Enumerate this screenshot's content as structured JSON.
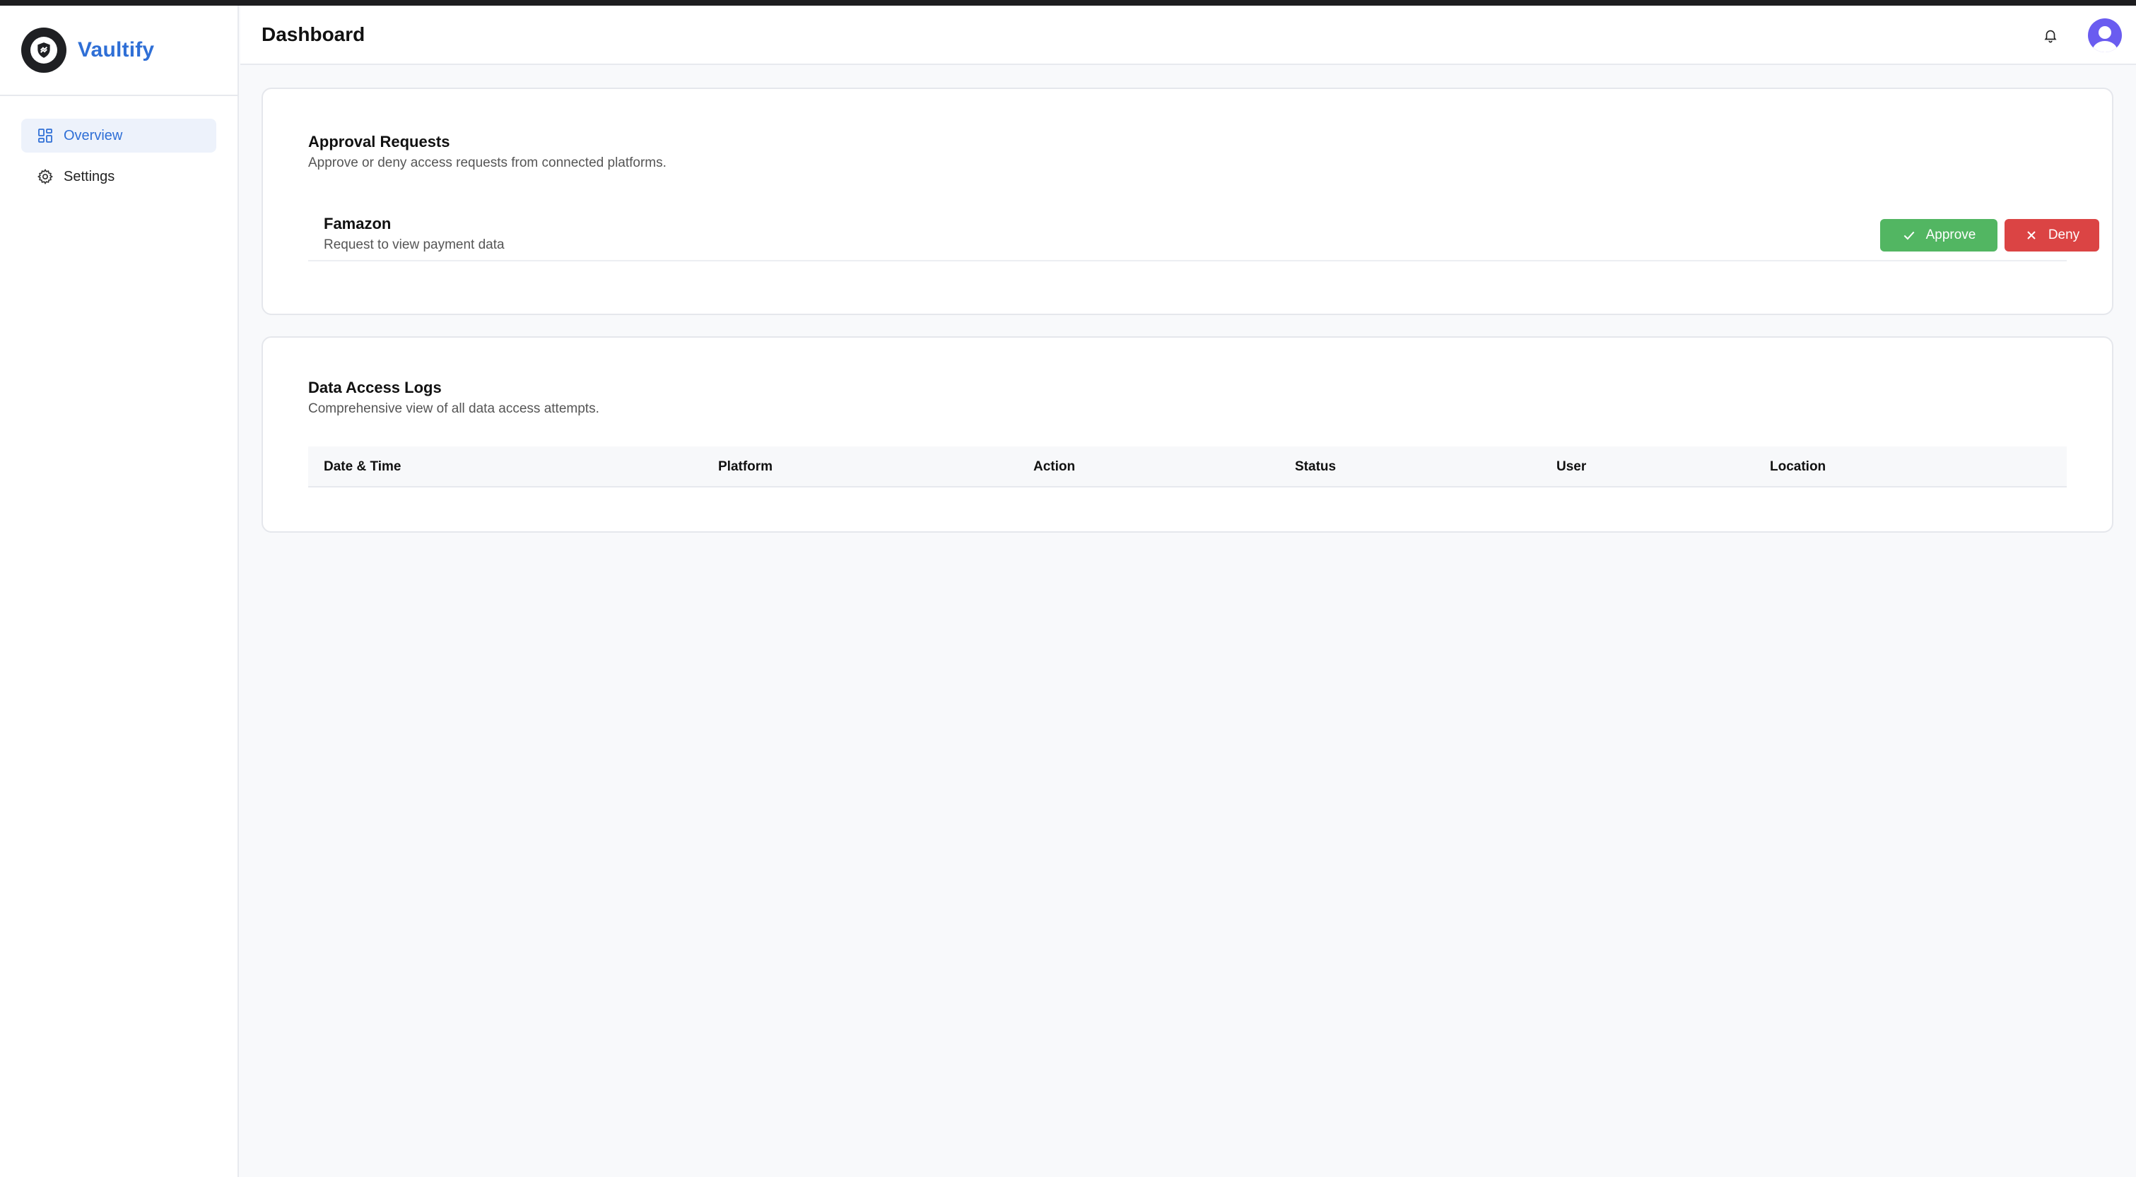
{
  "app": {
    "name": "Vaultify",
    "logo_icon": "shield-logo-icon"
  },
  "sidebar": {
    "items": [
      {
        "label": "Overview",
        "icon": "dashboard-grid-icon",
        "active": true
      },
      {
        "label": "Settings",
        "icon": "gear-icon",
        "active": false
      }
    ]
  },
  "header": {
    "title": "Dashboard",
    "notification_icon": "bell-icon",
    "avatar_icon": "user-avatar-icon"
  },
  "approvals": {
    "title": "Approval Requests",
    "subtitle": "Approve or deny access requests from connected platforms.",
    "requests": [
      {
        "platform": "Famazon",
        "description": "Request to view payment data",
        "approve_label": "Approve",
        "deny_label": "Deny"
      }
    ]
  },
  "logs": {
    "title": "Data Access Logs",
    "subtitle": "Comprehensive view of all data access attempts.",
    "columns": [
      "Date & Time",
      "Platform",
      "Action",
      "Status",
      "User",
      "Location"
    ],
    "rows": []
  },
  "colors": {
    "brand": "#2f6fd6",
    "approve": "#52b662",
    "deny": "#db4444",
    "avatar": "#6a5cf0"
  }
}
